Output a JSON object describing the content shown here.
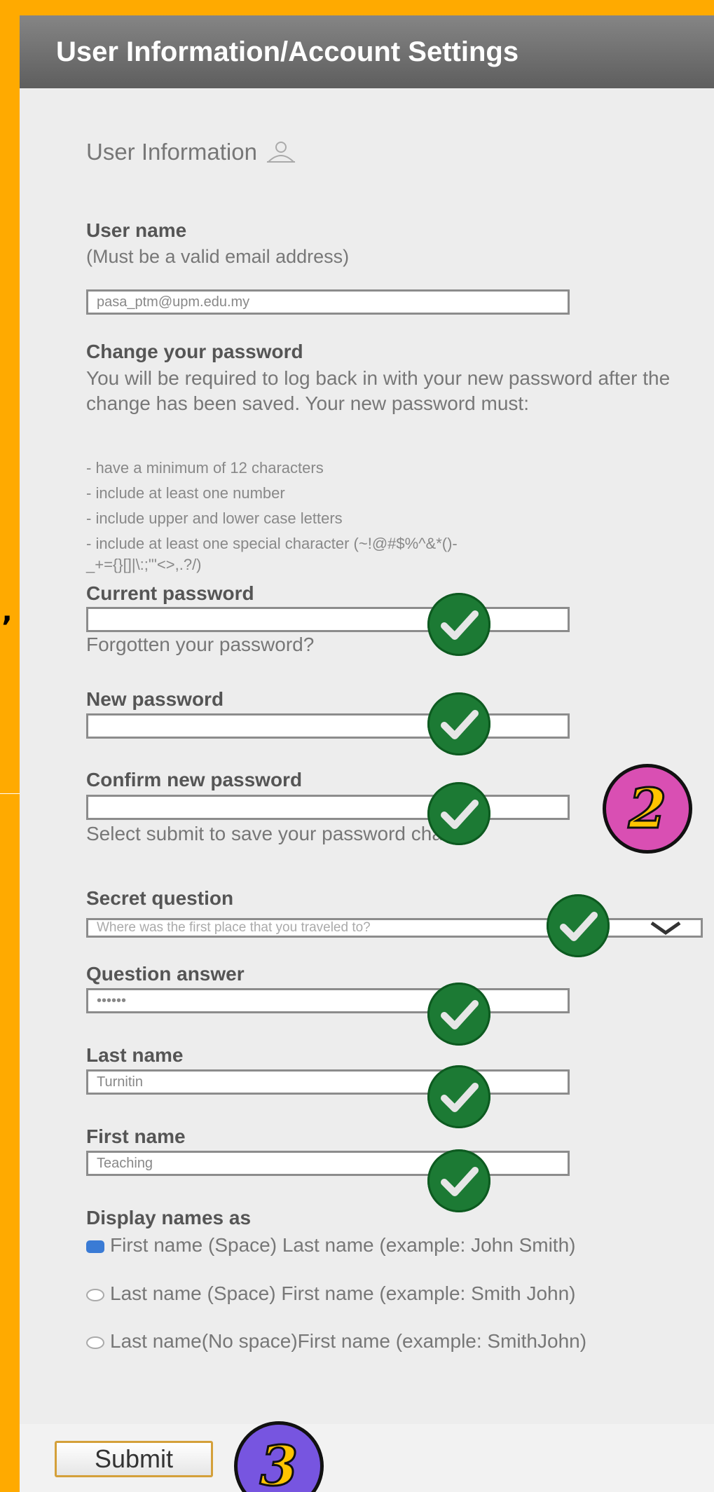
{
  "side": {
    "mark": "’"
  },
  "header": {
    "title": "User Information/Account Settings"
  },
  "section": {
    "title": "User Information",
    "icon": "user-icon"
  },
  "username": {
    "label": "User name",
    "hint": "(Must be a valid email address)",
    "value": "pasa_ptm@upm.edu.my"
  },
  "password_rules": {
    "heading": "Change your password",
    "intro": "You will be required to log back in with your new password after the change has been saved. Your new password must:",
    "rules": [
      "- have a minimum of 12 characters",
      "- include at least one number",
      "- include upper and lower case letters",
      "- include at least one special character (~!@#$%^&*()-",
      "_+={}[]|\\:;\"'<>,.?/)"
    ]
  },
  "current_password": {
    "label": "Current password",
    "value": "",
    "forgot_link": "Forgotten your password?"
  },
  "new_password": {
    "label": "New password",
    "value": ""
  },
  "confirm_password": {
    "label": "Confirm new password",
    "value": "",
    "hint": "Select submit to save your password change"
  },
  "secret_question": {
    "label": "Secret question",
    "selected": "Where was the first place that you traveled to?",
    "icon": "chevron-down-icon"
  },
  "question_answer": {
    "label": "Question answer",
    "value": "••••••"
  },
  "last_name": {
    "label": "Last name",
    "value": "Turnitin"
  },
  "first_name": {
    "label": "First name",
    "value": "Teaching"
  },
  "display_names": {
    "label": "Display names as",
    "options": [
      {
        "text": "First name (Space) Last name (example: John Smith)",
        "checked": true
      },
      {
        "text": "Last name (Space) First name (example: Smith John)",
        "checked": false
      },
      {
        "text": "Last name(No space)First name (example: SmithJohn)",
        "checked": false
      }
    ]
  },
  "footer": {
    "submit_label": "Submit"
  },
  "annotations": {
    "check_icon": "checkmark-icon",
    "check_color": "#1c7a34",
    "badge_2": {
      "text": "2",
      "color": "#D94FB3"
    },
    "badge_3": {
      "text": "3",
      "color": "#7755E0"
    }
  },
  "colors": {
    "background": "#FFAA00",
    "panel": "#EDEDED",
    "header_start": "#858585",
    "header_end": "#5e5e5e",
    "submit_border": "#d4a03a"
  }
}
